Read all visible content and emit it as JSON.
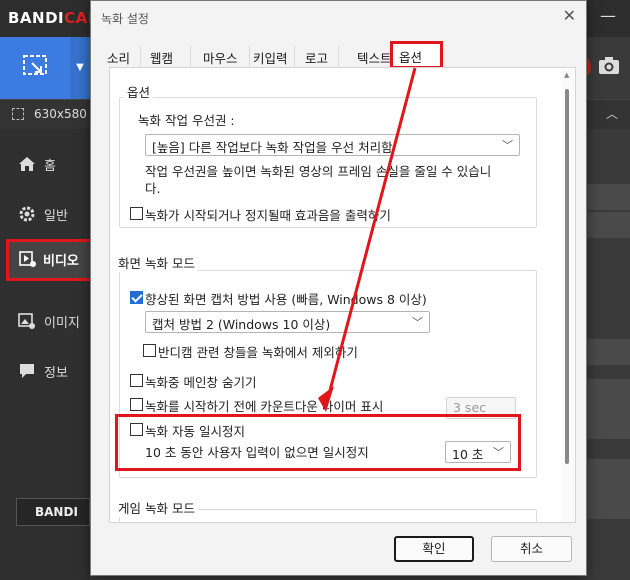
{
  "app": {
    "logo": "BANDICAM",
    "size_text": "630x580",
    "bottom_logo": "BANDI",
    "sidebar": [
      {
        "label": "홈",
        "icon": "home-icon"
      },
      {
        "label": "일반",
        "icon": "gear-icon"
      },
      {
        "label": "비디오",
        "icon": "video-settings-icon"
      },
      {
        "label": "이미지",
        "icon": "image-settings-icon"
      },
      {
        "label": "정보",
        "icon": "info-icon"
      }
    ]
  },
  "dialog": {
    "title": "녹화 설정",
    "tabs": [
      "소리",
      "웹캠",
      "마우스",
      "키입력",
      "로고",
      "텍스트",
      "옵션"
    ],
    "active_tab": "옵션",
    "options_group": {
      "title": "옵션",
      "priority_label": "녹화 작업 우선권 :",
      "priority_value": "[높음] 다른 작업보다 녹화 작업을 우선 처리함",
      "priority_help_1": "작업 우선권을 높이면 녹화된 영상의 프레임 손실을 줄일 수 있습니",
      "priority_help_2": "다.",
      "effect_sound": "녹화가 시작되거나 정지될때 효과음을 출력하기"
    },
    "screen_group": {
      "title": "화면 녹화 모드",
      "enhanced_capture": "향상된 화면 캡처 방법 사용 (빠름, Windows 8 이상)",
      "capture_method": "캡처 방법 2 (Windows 10 이상)",
      "exclude_windows": "반디캠 관련 창들을 녹화에서 제외하기",
      "hide_main": "녹화중 메인창 숨기기",
      "countdown": "녹화를 시작하기 전에 카운트다운 타이머 표시",
      "countdown_value": "3 sec",
      "auto_pause": "녹화 자동 일시정지",
      "auto_pause_desc": "10 초 동안 사용자 입력이 없으면 일시정지",
      "auto_pause_value": "10 초"
    },
    "game_group": {
      "title": "게임 녹화 모드"
    },
    "ok": "확인",
    "cancel": "취소"
  },
  "colors": {
    "accent": "#1f6fd4",
    "highlight": "#e0161b",
    "app_blue": "#3c7be0"
  }
}
